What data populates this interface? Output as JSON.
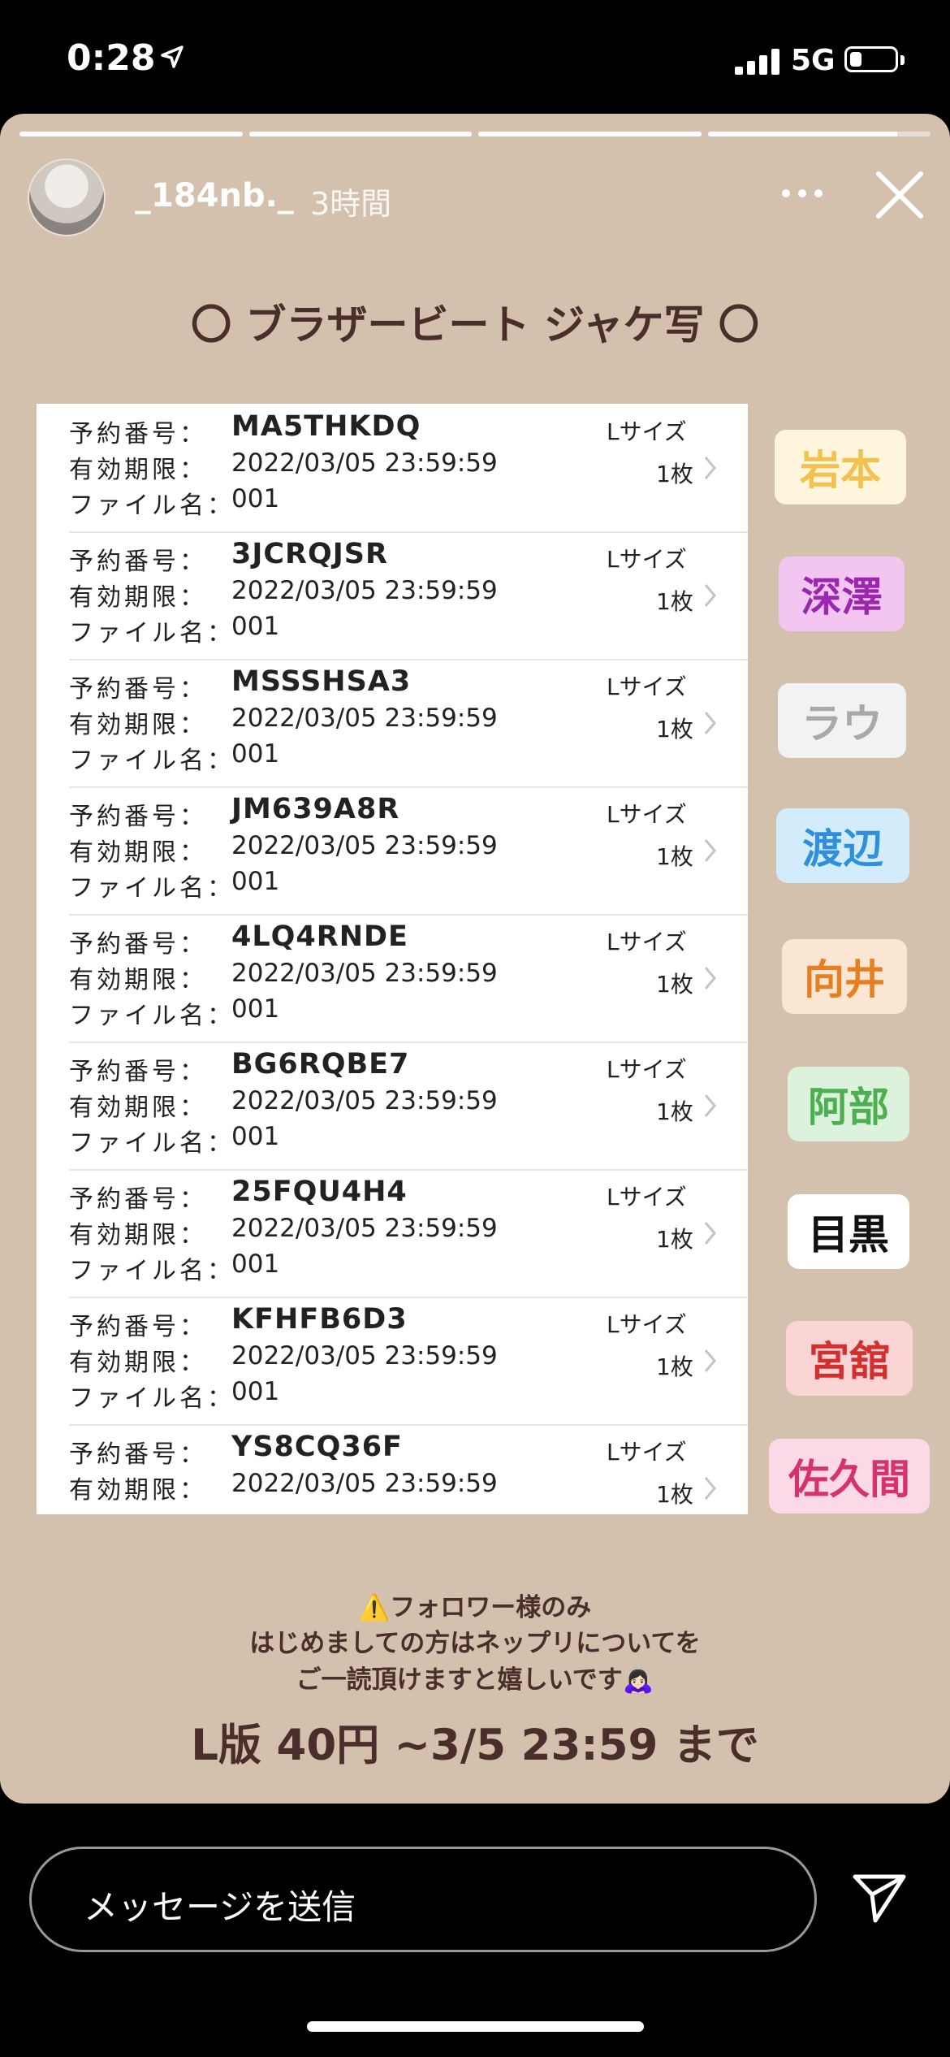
{
  "status_bar": {
    "time": "0:28",
    "network": "5G",
    "battery_level": 0.25
  },
  "story": {
    "progress": [
      1.0,
      1.0,
      1.0,
      0.85
    ],
    "username": "_184nb._",
    "time_ago": "3時間",
    "title": "〇 ブラザービート ジャケ写 〇",
    "labels": {
      "reserve": "予約番号：",
      "expiry": "有効期限：",
      "file": "ファイル名："
    },
    "orders": [
      {
        "code": "MA5THKDQ",
        "expiry": "2022/03/05 23:59:59",
        "file": "001",
        "size": "Lサイズ",
        "count": "1枚"
      },
      {
        "code": "3JCRQJSR",
        "expiry": "2022/03/05 23:59:59",
        "file": "001",
        "size": "Lサイズ",
        "count": "1枚"
      },
      {
        "code": "MSSSHSA3",
        "expiry": "2022/03/05 23:59:59",
        "file": "001",
        "size": "Lサイズ",
        "count": "1枚"
      },
      {
        "code": "JM639A8R",
        "expiry": "2022/03/05 23:59:59",
        "file": "001",
        "size": "Lサイズ",
        "count": "1枚"
      },
      {
        "code": "4LQ4RNDE",
        "expiry": "2022/03/05 23:59:59",
        "file": "001",
        "size": "Lサイズ",
        "count": "1枚"
      },
      {
        "code": "BG6RQBE7",
        "expiry": "2022/03/05 23:59:59",
        "file": "001",
        "size": "Lサイズ",
        "count": "1枚"
      },
      {
        "code": "25FQU4H4",
        "expiry": "2022/03/05 23:59:59",
        "file": "001",
        "size": "Lサイズ",
        "count": "1枚"
      },
      {
        "code": "KFHFB6D3",
        "expiry": "2022/03/05 23:59:59",
        "file": "001",
        "size": "Lサイズ",
        "count": "1枚"
      },
      {
        "code": "YS8CQ36F",
        "expiry": "2022/03/05 23:59:59",
        "file": "",
        "size": "Lサイズ",
        "count": "1枚"
      }
    ],
    "name_tags": [
      {
        "name": "岩本",
        "color": "#f2c14e",
        "bg": "#fdf6dc"
      },
      {
        "name": "深澤",
        "color": "#9b27b0",
        "bg": "#f3c6f1"
      },
      {
        "name": "ラウ",
        "color": "#a9a9a9",
        "bg": "#f2f2f2"
      },
      {
        "name": "渡辺",
        "color": "#2f8fdc",
        "bg": "#d2ecfb"
      },
      {
        "name": "向井",
        "color": "#e67e22",
        "bg": "#fbe6d3"
      },
      {
        "name": "阿部",
        "color": "#4caf50",
        "bg": "#dcf2dc"
      },
      {
        "name": "目黒",
        "color": "#111111",
        "bg": "#ffffff"
      },
      {
        "name": "宮舘",
        "color": "#d32f2f",
        "bg": "#fbd5d5"
      },
      {
        "name": "佐久間",
        "color": "#d6336c",
        "bg": "#fbd9e6"
      }
    ],
    "note_lines": [
      "⚠️フォロワー様のみ",
      "はじめましての方はネップリについてを",
      "ご一読頂けますと嬉しいです🙇🏻‍♀️"
    ],
    "price": "L版 40円 ~3/5 23:59 まで"
  },
  "message_bar": {
    "placeholder": "メッセージを送信"
  }
}
